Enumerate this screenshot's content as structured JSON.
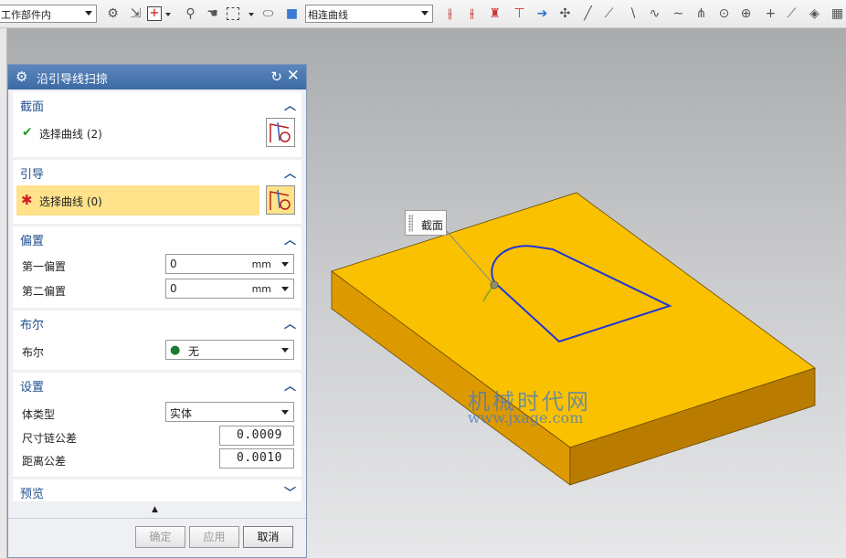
{
  "toolbar": {
    "filter_select": "工作部件内",
    "curve_rule_select": "相连曲线"
  },
  "dialog": {
    "title": "沿引导线扫掠",
    "sections": {
      "section": {
        "title": "截面",
        "select_label": "选择曲线 (2)"
      },
      "guide": {
        "title": "引导",
        "select_label": "选择曲线 (0)"
      },
      "offset": {
        "title": "偏置",
        "first_label": "第一偏置",
        "first_value": "0",
        "first_unit": "mm",
        "second_label": "第二偏置",
        "second_value": "0",
        "second_unit": "mm"
      },
      "boolean": {
        "title": "布尔",
        "label": "布尔",
        "value": "无"
      },
      "settings": {
        "title": "设置",
        "body_type_label": "体类型",
        "body_type_value": "实体",
        "chain_tol_label": "尺寸链公差",
        "chain_tol_value": "0.0009",
        "dist_tol_label": "距离公差",
        "dist_tol_value": "0.0010"
      },
      "preview": {
        "title": "预览"
      }
    },
    "buttons": {
      "ok": "确定",
      "apply": "应用",
      "cancel": "取消"
    }
  },
  "viewport": {
    "tooltip": "截面",
    "watermark_cn": "机械时代网",
    "watermark_url": "www.jxage.com"
  },
  "colors": {
    "accent": "#3d6aa4",
    "guide_highlight": "#ffe28a",
    "block_top": "#f9c100",
    "block_front": "#dd9a00",
    "block_side": "#b97c00",
    "section_curve": "#2036d8"
  }
}
